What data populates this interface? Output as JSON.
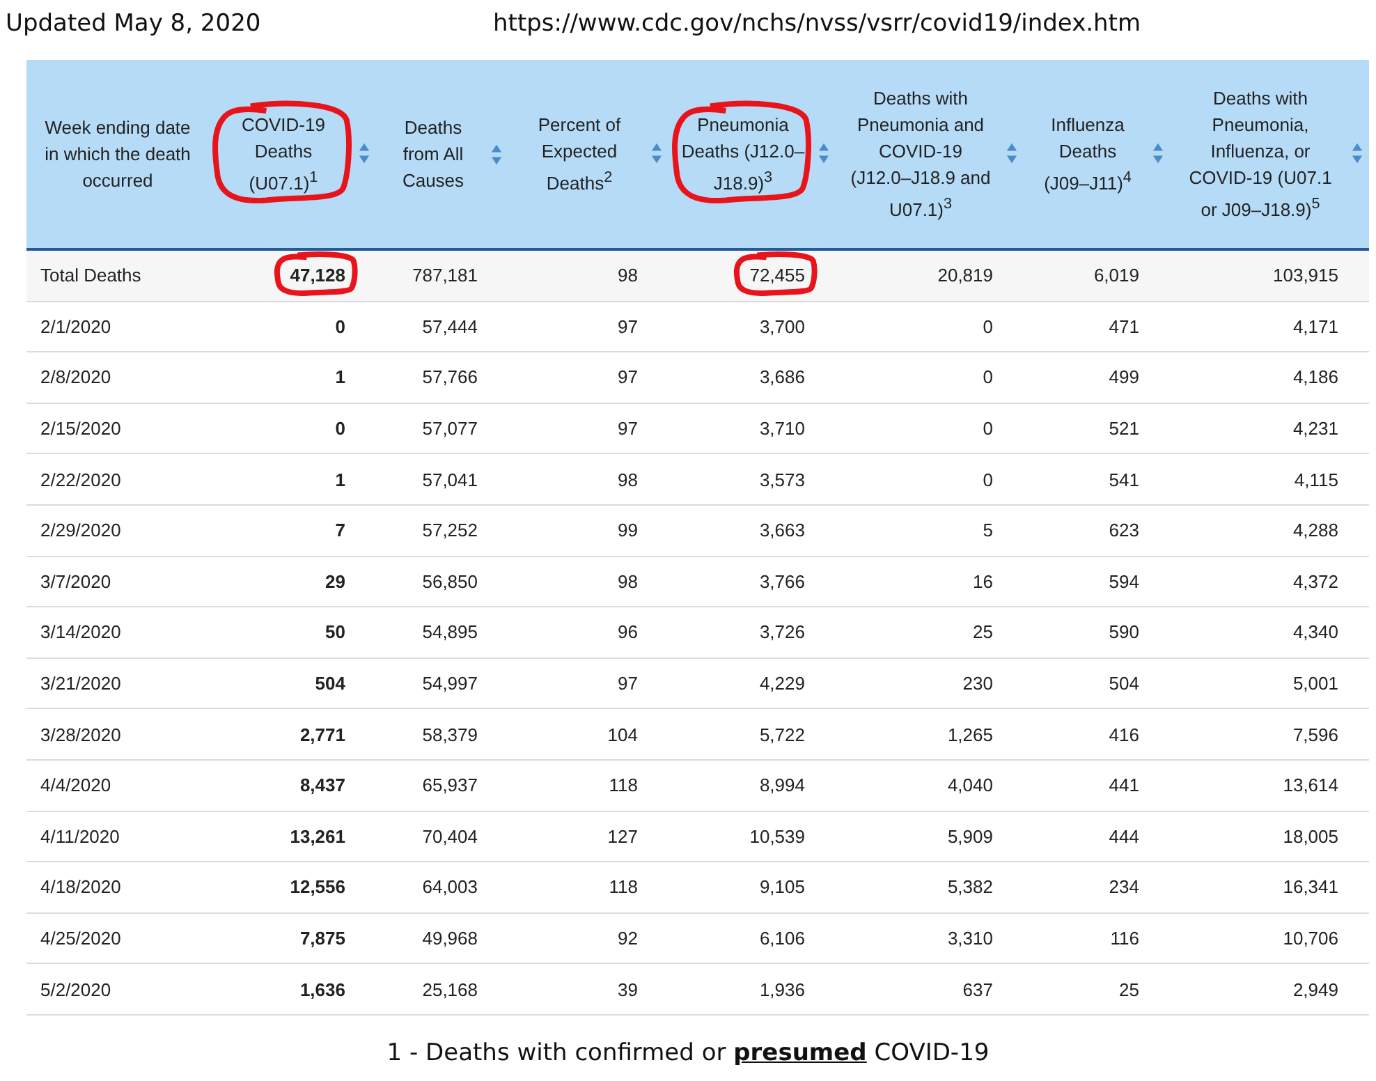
{
  "updated": "Updated May 8, 2020",
  "url": "https://www.cdc.gov/nchs/nvss/vsrr/covid19/index.htm",
  "columns": [
    {
      "label": "Week ending date in which the death occurred",
      "sortable": false,
      "circled": false,
      "bold": false
    },
    {
      "label": "COVID-19 Deaths (U07.1)$^{1}$",
      "sortable": true,
      "circled": true,
      "bold": true
    },
    {
      "label": "Deaths from All Causes",
      "sortable": true,
      "circled": false,
      "bold": false
    },
    {
      "label": "Percent of Expected Deaths$^{2}$",
      "sortable": true,
      "circled": false,
      "bold": false
    },
    {
      "label": "Pneumonia Deaths (J12.0–J18.9)$^{3}$",
      "sortable": true,
      "circled": true,
      "bold": false
    },
    {
      "label": "Deaths with Pneumonia and COVID-19 (J12.0–J18.9 and U07.1)$^{3}$",
      "sortable": true,
      "circled": false,
      "bold": false
    },
    {
      "label": "Influenza Deaths (J09–J11)$^{4}$",
      "sortable": true,
      "circled": false,
      "bold": false
    },
    {
      "label": "Deaths with Pneumonia, Influenza, or COVID-19 (U07.1 or J09–J18.9)$^{5}$",
      "sortable": true,
      "circled": false,
      "bold": false
    }
  ],
  "total_row": [
    {
      "text": "Total Deaths",
      "circled": false
    },
    {
      "text": "47,128",
      "circled": true
    },
    {
      "text": "787,181",
      "circled": false
    },
    {
      "text": "98",
      "circled": false
    },
    {
      "text": "72,455",
      "circled": true
    },
    {
      "text": "20,819",
      "circled": false
    },
    {
      "text": "6,019",
      "circled": false
    },
    {
      "text": "103,915",
      "circled": false
    }
  ],
  "rows": [
    [
      "2/1/2020",
      "0",
      "57,444",
      "97",
      "3,700",
      "0",
      "471",
      "4,171"
    ],
    [
      "2/8/2020",
      "1",
      "57,766",
      "97",
      "3,686",
      "0",
      "499",
      "4,186"
    ],
    [
      "2/15/2020",
      "0",
      "57,077",
      "97",
      "3,710",
      "0",
      "521",
      "4,231"
    ],
    [
      "2/22/2020",
      "1",
      "57,041",
      "98",
      "3,573",
      "0",
      "541",
      "4,115"
    ],
    [
      "2/29/2020",
      "7",
      "57,252",
      "99",
      "3,663",
      "5",
      "623",
      "4,288"
    ],
    [
      "3/7/2020",
      "29",
      "56,850",
      "98",
      "3,766",
      "16",
      "594",
      "4,372"
    ],
    [
      "3/14/2020",
      "50",
      "54,895",
      "96",
      "3,726",
      "25",
      "590",
      "4,340"
    ],
    [
      "3/21/2020",
      "504",
      "54,997",
      "97",
      "4,229",
      "230",
      "504",
      "5,001"
    ],
    [
      "3/28/2020",
      "2,771",
      "58,379",
      "104",
      "5,722",
      "1,265",
      "416",
      "7,596"
    ],
    [
      "4/4/2020",
      "8,437",
      "65,937",
      "118",
      "8,994",
      "4,040",
      "441",
      "13,614"
    ],
    [
      "4/11/2020",
      "13,261",
      "70,404",
      "127",
      "10,539",
      "5,909",
      "444",
      "18,005"
    ],
    [
      "4/18/2020",
      "12,556",
      "64,003",
      "118",
      "9,105",
      "5,382",
      "234",
      "16,341"
    ],
    [
      "4/25/2020",
      "7,875",
      "49,968",
      "92",
      "6,106",
      "3,310",
      "116",
      "10,706"
    ],
    [
      "5/2/2020",
      "1,636",
      "25,168",
      "39",
      "1,936",
      "637",
      "25",
      "2,949"
    ]
  ],
  "footnote": "1 - Deaths with confirmed or **presumed** COVID-19"
}
